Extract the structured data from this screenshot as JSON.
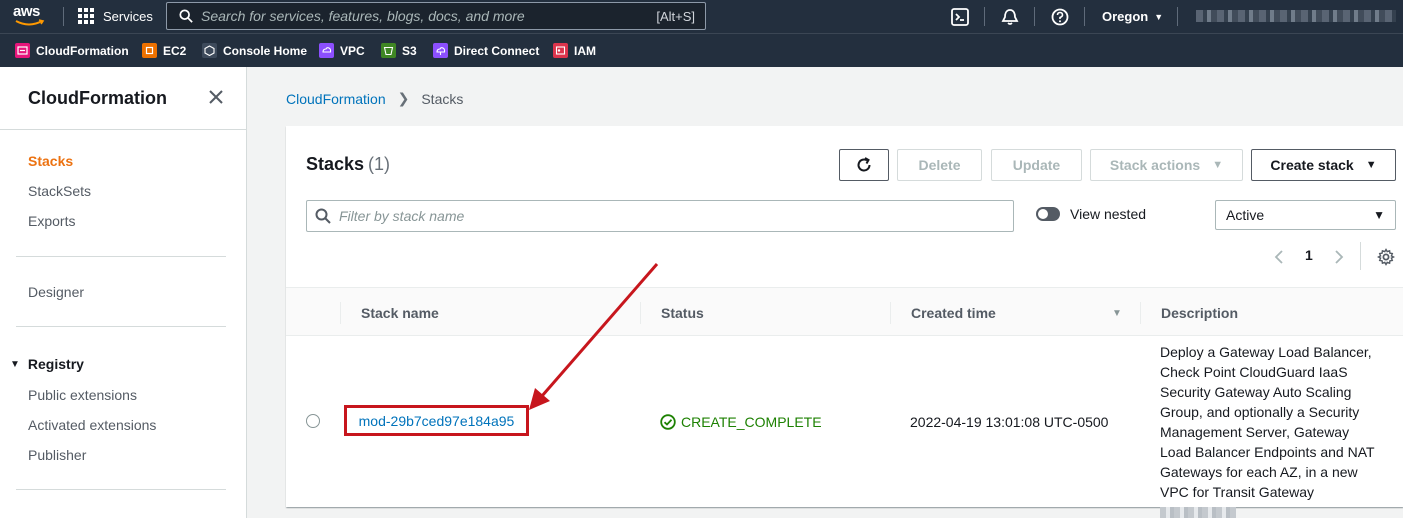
{
  "topnav": {
    "logo_text": "aws",
    "services_label": "Services",
    "search_placeholder": "Search for services, features, blogs, docs, and more",
    "search_shortcut": "[Alt+S]",
    "region": "Oregon"
  },
  "favorites": [
    {
      "label": "CloudFormation",
      "color": "#e7157b"
    },
    {
      "label": "EC2",
      "color": "#ed7100"
    },
    {
      "label": "Console Home",
      "color": "#3d4a5b"
    },
    {
      "label": "VPC",
      "color": "#8c4fff"
    },
    {
      "label": "S3",
      "color": "#3f8624"
    },
    {
      "label": "Direct Connect",
      "color": "#8c4fff"
    },
    {
      "label": "IAM",
      "color": "#dd344c"
    }
  ],
  "sidebar": {
    "title": "CloudFormation",
    "items": [
      "Stacks",
      "StackSets",
      "Exports"
    ],
    "designer": "Designer",
    "registry_title": "Registry",
    "registry_items": [
      "Public extensions",
      "Activated extensions",
      "Publisher"
    ]
  },
  "breadcrumb": {
    "root": "CloudFormation",
    "current": "Stacks"
  },
  "panel": {
    "title": "Stacks",
    "count": "(1)",
    "buttons": {
      "delete": "Delete",
      "update": "Update",
      "stack_actions": "Stack actions",
      "create_stack": "Create stack"
    },
    "filter_placeholder": "Filter by stack name",
    "view_nested": "View nested",
    "status_filter": "Active",
    "page": "1"
  },
  "table": {
    "headers": [
      "Stack name",
      "Status",
      "Created time",
      "Description"
    ],
    "rows": [
      {
        "name": "mod-29b7ced97e184a95",
        "status": "CREATE_COMPLETE",
        "created": "2022-04-19 13:01:08 UTC-0500",
        "description": "Deploy a Gateway Load Balancer, Check Point CloudGuard IaaS Security Gateway Auto Scaling Group, and optionally a Security Management Server, Gateway Load Balancer Endpoints and NAT Gateways for each AZ, in a new VPC for Transit Gateway"
      }
    ]
  },
  "colors": {
    "nav_bg": "#232f3e",
    "link": "#0073bb",
    "active": "#ec7211",
    "success": "#1d8102",
    "annotation": "#c7161d"
  }
}
